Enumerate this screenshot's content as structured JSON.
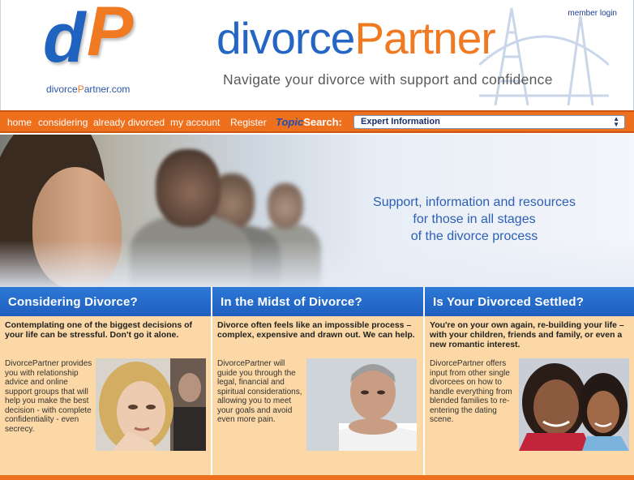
{
  "header": {
    "member_login": "member login",
    "logo_letters": [
      "d",
      "P"
    ],
    "logo_url_prefix": "divorce",
    "logo_url_highlight": "P",
    "logo_url_suffix": "artner.com",
    "brand_part1": "divorce",
    "brand_part2": "Partner",
    "tagline": "Navigate your divorce with support and confidence"
  },
  "nav": {
    "items": [
      "home",
      "considering",
      "already divorced",
      "my account",
      "Register"
    ],
    "topic_label_1": "Topic",
    "topic_label_2": "Search:",
    "topic_selected": "Expert Information"
  },
  "hero": {
    "lines": [
      "Support, information and resources",
      "for those in all stages",
      "of the divorce process"
    ]
  },
  "columns": [
    {
      "title": "Considering Divorce?",
      "lead": "Contemplating one of the biggest decisions of your life can be stressful. Don't go it alone.",
      "body": "DivorcePartner provides you with relationship advice and online support groups that will help you make the best decision - with complete confidentiality - even secrecy."
    },
    {
      "title": "In the Midst of Divorce?",
      "lead": "Divorce often feels like an impossible process – complex, expensive and drawn out. We can help.",
      "body": "DivorcePartner will guide you through the legal, financial and spiritual considerations, allowing you to meet your goals and avoid even more pain."
    },
    {
      "title": "Is Your Divorced Settled?",
      "lead": "You're on your own again, re-building your life – with your children, friends and family, or even a new romantic interest.",
      "body": "DivorcePartner offers input from other single divorcees on how to handle everything from blended families to re-entering the dating scene."
    }
  ],
  "colors": {
    "brand_blue": "#2566c4",
    "brand_orange": "#f07a22",
    "nav_orange": "#ee6f1c",
    "column_bg": "#fbd8a5"
  }
}
